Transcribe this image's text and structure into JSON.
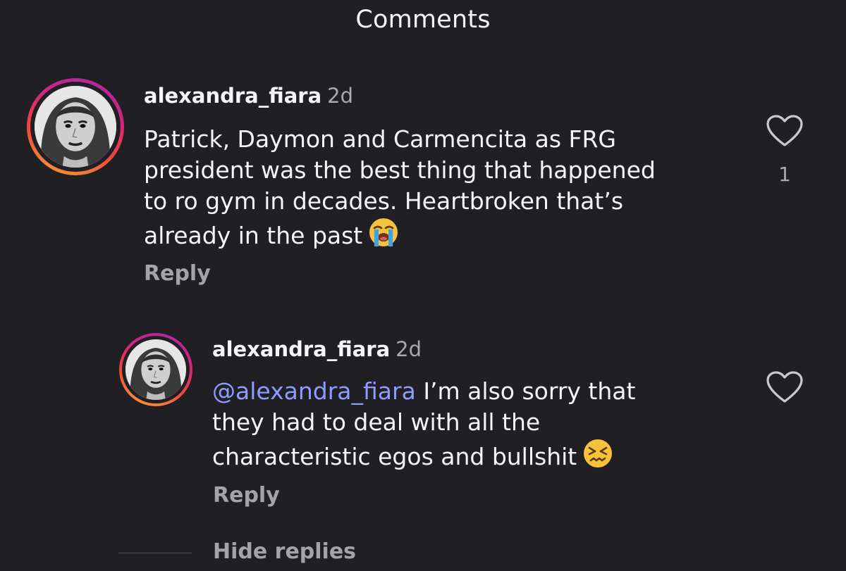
{
  "header": {
    "title": "Comments"
  },
  "comments": [
    {
      "username": "alexandra_fiara",
      "time": "2d",
      "lines": [
        "Patrick, Daymon and Carmencita as FRG",
        "president was the best thing that happened",
        "to ro gym in decades. Heartbroken that’s",
        "already in the past"
      ],
      "emoji": "loudly-crying-face",
      "reply_label": "Reply",
      "like_icon": "heart-outline-icon",
      "like_count": "1"
    }
  ],
  "replies": [
    {
      "username": "alexandra_fiara",
      "time": "2d",
      "mention": "@alexandra_fiara",
      "lines": [
        "I’m also sorry that",
        "they had to deal with all the",
        "characteristic egos and bullshit"
      ],
      "emoji": "confounded-face",
      "reply_label": "Reply",
      "like_icon": "heart-outline-icon"
    }
  ],
  "thread": {
    "hide_replies_label": "Hide replies"
  },
  "colors": {
    "background": "#202024",
    "text": "#f5f5f7",
    "muted": "#a8a8ad",
    "mention": "#8c9cff",
    "avatar_ring_start": "#a32aa8",
    "avatar_ring_end": "#f6a93a"
  }
}
